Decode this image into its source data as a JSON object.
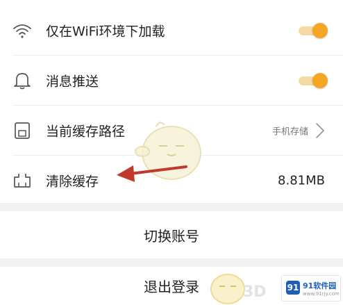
{
  "settings": {
    "wifi_download_label": "仅在WiFi环境下加载",
    "wifi_download_enabled": true,
    "push_label": "消息推送",
    "push_enabled": true,
    "cache_path_label": "当前缓存路径",
    "cache_path_value": "手机存储",
    "clear_cache_label": "清除缓存",
    "cache_size": "8.81MB"
  },
  "actions": {
    "switch_account_label": "切换账号",
    "logout_label": "退出登录"
  },
  "watermark": {
    "text_3d": "3D",
    "logo_mark": "91",
    "logo_text": "91软件园",
    "logo_url": "www.91rjy.com"
  },
  "colors": {
    "accent": "#f5a623",
    "annotation_arrow": "#c0392b"
  }
}
